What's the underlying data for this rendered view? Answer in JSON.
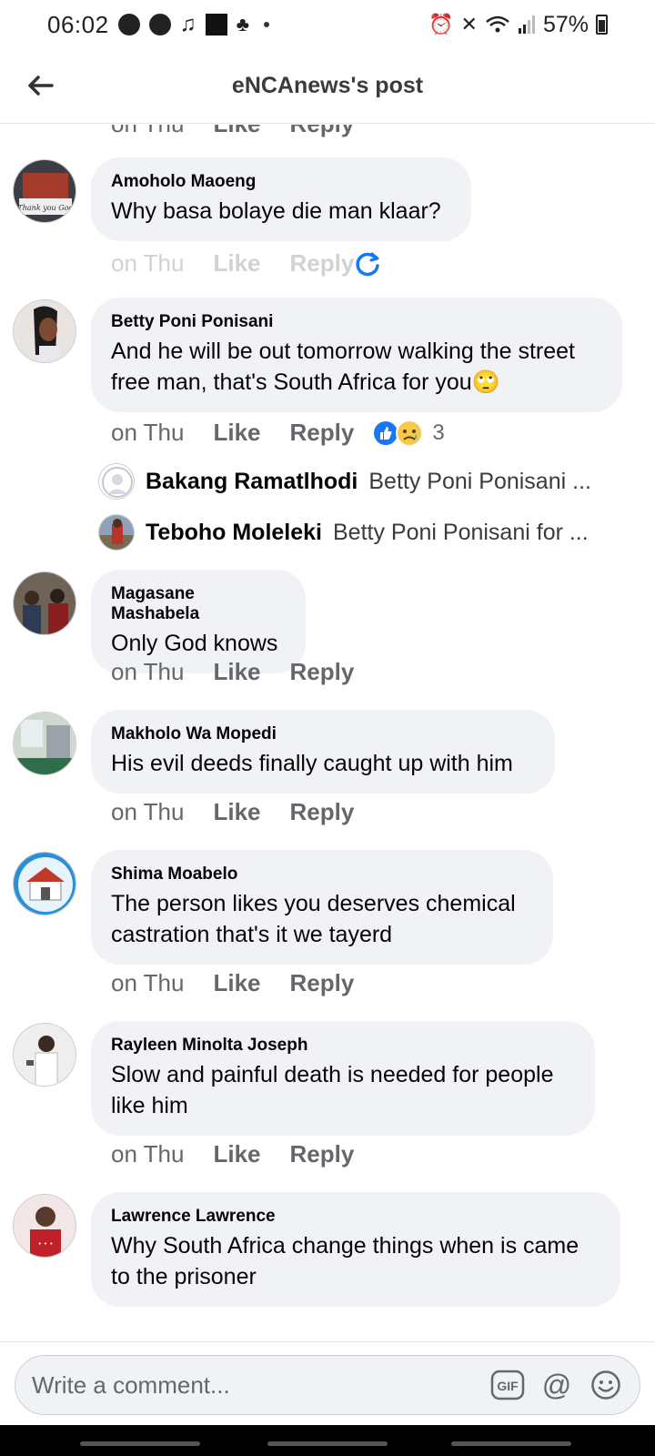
{
  "status_bar": {
    "time": "06:02",
    "battery": "57%"
  },
  "header": {
    "title": "eNCAnews's post"
  },
  "top_partial": {
    "time": "on Thu",
    "like": "Like",
    "reply": "Reply"
  },
  "comments": [
    {
      "author": "Amoholo Maoeng",
      "text": "Why basa bolaye die man klaar?",
      "time": "on Thu",
      "like": "Like",
      "reply": "Reply"
    },
    {
      "author": "Betty Poni Ponisani",
      "text": "And he will be out tomorrow walking the street free man, that's South Africa for you🙄",
      "time": "on Thu",
      "like": "Like",
      "reply": "Reply",
      "reaction_count": "3"
    },
    {
      "author": "Magasane Mashabela",
      "text": "Only God knows",
      "time": "on Thu",
      "like": "Like",
      "reply": "Reply"
    },
    {
      "author": "Makholo Wa Mopedi",
      "text": "His evil deeds finally caught up with him",
      "time": "on Thu",
      "like": "Like",
      "reply": "Reply"
    },
    {
      "author": "Shima Moabelo",
      "text": "The person likes you deserves chemical castration that's it we tayerd",
      "time": "on Thu",
      "like": "Like",
      "reply": "Reply"
    },
    {
      "author": "Rayleen Minolta Joseph",
      "text": "Slow and painful death is needed for people like him",
      "time": "on Thu",
      "like": "Like",
      "reply": "Reply"
    },
    {
      "author": "Lawrence Lawrence",
      "text": "Why South Africa change things when is came to the prisoner",
      "time": "",
      "like": "",
      "reply": ""
    }
  ],
  "replies": [
    {
      "name": "Bakang Ramatlhodi",
      "preview": "Betty Poni Ponisani ..."
    },
    {
      "name": "Teboho Moleleki",
      "preview": "Betty Poni Ponisani for ..."
    }
  ],
  "composer": {
    "placeholder": "Write a comment...",
    "gif_label": "GIF",
    "mention_label": "@"
  }
}
